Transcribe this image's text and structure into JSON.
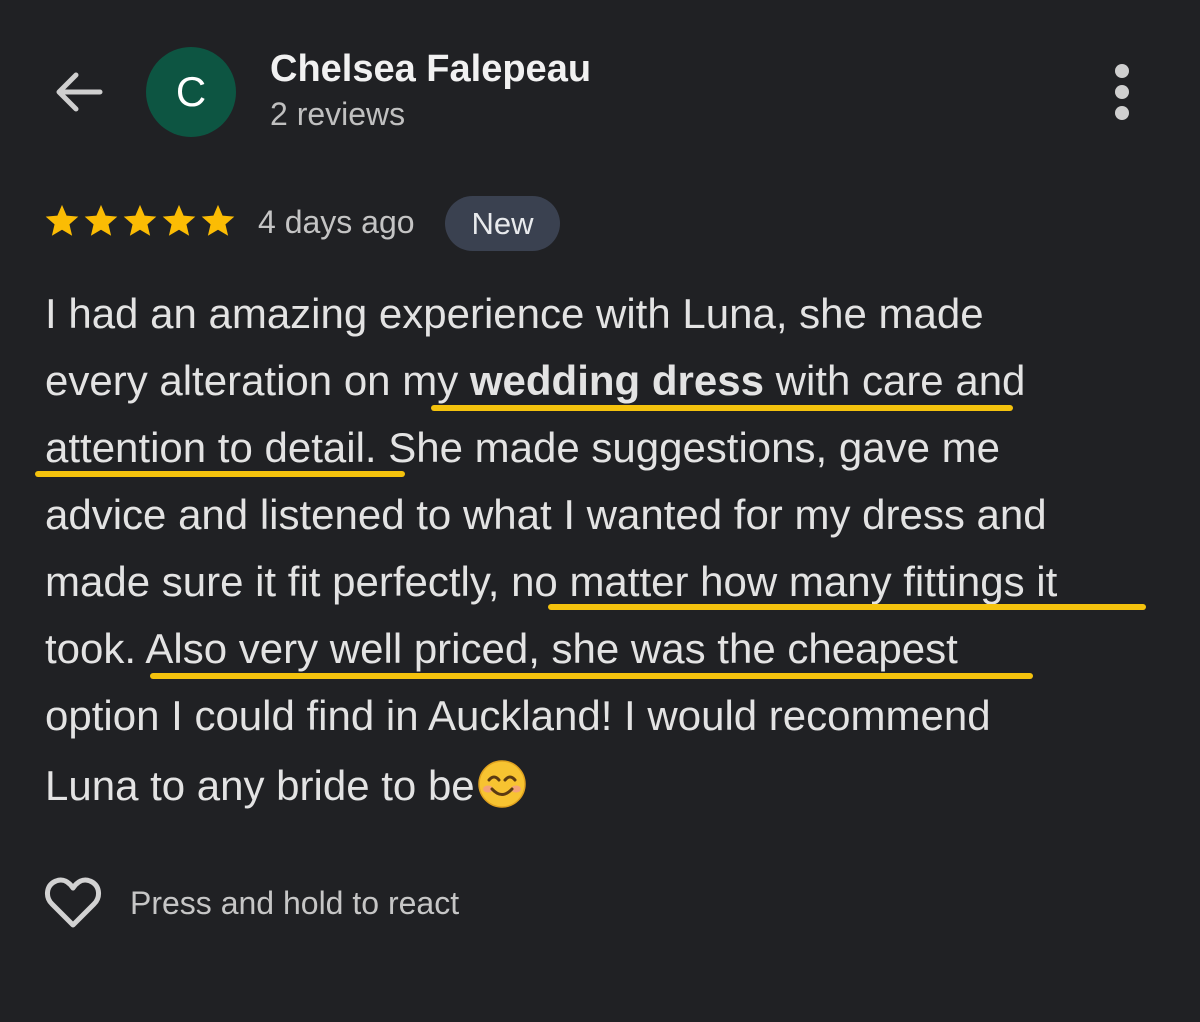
{
  "header": {
    "back_icon": "arrow-left-icon",
    "avatar_letter": "C",
    "avatar_color": "#0d5542",
    "reviewer_name": "Chelsea Falepeau",
    "review_count": "2 reviews",
    "menu_icon": "more-vertical-icon"
  },
  "review": {
    "rating": 5,
    "max_rating": 5,
    "star_color": "#fbbc04",
    "date": "4 days ago",
    "badge": "New",
    "lines": [
      [
        "I had an amazing experience with Luna, she made"
      ],
      [
        "every alteration on ",
        "my ",
        "wedding dress",
        " with care",
        " and"
      ],
      [
        "attention to detail.",
        " She made suggestions, gave me"
      ],
      [
        "advice and listened to what I wanted for my dress and"
      ],
      [
        "made sure it fit perfectly, ",
        "no matter how many fittings it"
      ],
      [
        "took. ",
        "Also very well priced, she was the cheapest"
      ],
      [
        "option I could find in Auckland! I would recommend"
      ],
      [
        "Luna to any bride to be"
      ]
    ],
    "emoji": "smiling-face-icon",
    "highlight_color": "#f4c20d"
  },
  "footer": {
    "heart_icon": "heart-outline-icon",
    "react_label": "Press and hold to react"
  }
}
